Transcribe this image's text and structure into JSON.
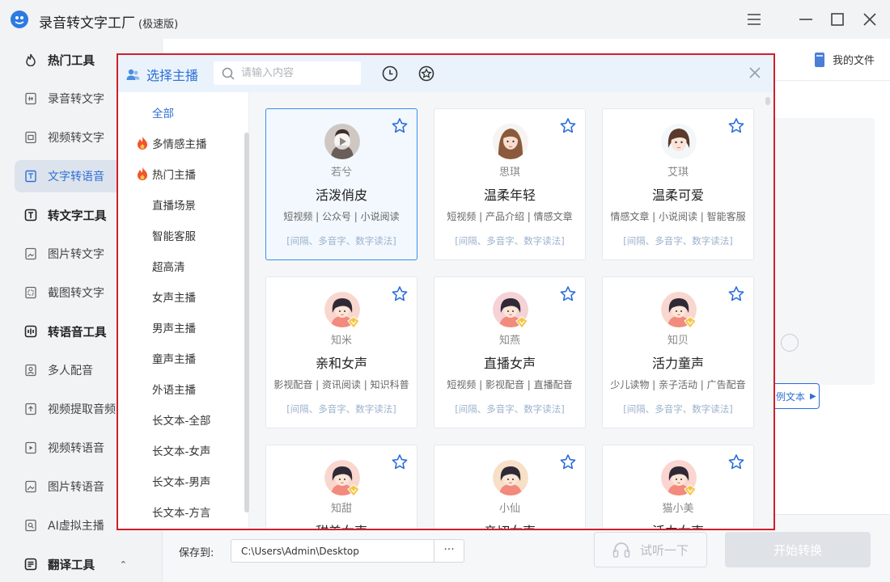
{
  "app": {
    "title": "录音转文字工厂",
    "edition": "(极速版)"
  },
  "sidebar": {
    "items": [
      {
        "label": "热门工具",
        "type": "section",
        "icon": "flame-outline-icon"
      },
      {
        "label": "录音转文字",
        "type": "item",
        "icon": "audio-file-icon"
      },
      {
        "label": "视频转文字",
        "type": "item",
        "icon": "video-file-icon"
      },
      {
        "label": "文字转语音",
        "type": "item",
        "icon": "text-file-icon",
        "active": true
      },
      {
        "label": "转文字工具",
        "type": "section",
        "icon": "text-t-icon"
      },
      {
        "label": "图片转文字",
        "type": "item",
        "icon": "image-file-icon"
      },
      {
        "label": "截图转文字",
        "type": "item",
        "icon": "screenshot-icon"
      },
      {
        "label": "转语音工具",
        "type": "section",
        "icon": "waveform-icon"
      },
      {
        "label": "多人配音",
        "type": "item",
        "icon": "person-icon"
      },
      {
        "label": "视频提取音频",
        "type": "item",
        "icon": "extract-audio-icon"
      },
      {
        "label": "视频转语音",
        "type": "item",
        "icon": "play-file-icon"
      },
      {
        "label": "图片转语音",
        "type": "item",
        "icon": "picture-icon"
      },
      {
        "label": "AI虚拟主播",
        "type": "item",
        "icon": "ai-anchor-icon"
      },
      {
        "label": "翻译工具",
        "type": "section",
        "icon": "translate-icon"
      }
    ]
  },
  "main": {
    "my_files": "我的文件",
    "example_text": "例文本",
    "save_label": "保存到:",
    "save_path": "C:\\Users\\Admin\\Desktop",
    "path_more": "···",
    "listen_label": "试听一下",
    "start_label": "开始转换"
  },
  "modal": {
    "title": "选择主播",
    "search_placeholder": "请输入内容",
    "categories": [
      {
        "label": "全部",
        "active": true
      },
      {
        "label": "多情感主播",
        "hot": true
      },
      {
        "label": "热门主播",
        "hot": true
      },
      {
        "label": "直播场景"
      },
      {
        "label": "智能客服"
      },
      {
        "label": "超高清"
      },
      {
        "label": "女声主播"
      },
      {
        "label": "男声主播"
      },
      {
        "label": "童声主播"
      },
      {
        "label": "外语主播"
      },
      {
        "label": "长文本-全部"
      },
      {
        "label": "长文本-女声"
      },
      {
        "label": "长文本-男声"
      },
      {
        "label": "长文本-方言"
      }
    ],
    "anchors": [
      {
        "name": "若兮",
        "style": "活泼俏皮",
        "tags": "短视频 | 公众号 | 小说阅读",
        "features": "[间隔、多音字、数字读法]",
        "selected": true,
        "avatar": "play"
      },
      {
        "name": "思琪",
        "style": "温柔年轻",
        "tags": "短视频 | 产品介绍 | 情感文章",
        "features": "[间隔、多音字、数字读法]",
        "avatar": "long-hair"
      },
      {
        "name": "艾琪",
        "style": "温柔可爱",
        "tags": "情感文章 | 小说阅读 | 智能客服",
        "features": "[间隔、多音字、数字读法]",
        "avatar": "cute"
      },
      {
        "name": "知米",
        "style": "亲和女声",
        "tags": "影视配音 | 资讯阅读 | 知识科普",
        "features": "[间隔、多音字、数字读法]",
        "avatar": "cartoon",
        "badge": true
      },
      {
        "name": "知燕",
        "style": "直播女声",
        "tags": "短视频 | 影视配音 | 直播配音",
        "features": "[间隔、多音字、数字读法]",
        "avatar": "cartoon",
        "badge": true
      },
      {
        "name": "知贝",
        "style": "活力童声",
        "tags": "少儿读物 | 亲子活动 | 广告配音",
        "features": "[间隔、多音字、数字读法]",
        "avatar": "cartoon",
        "badge": true
      },
      {
        "name": "知甜",
        "style": "甜美女声",
        "tags": "",
        "features": "",
        "avatar": "cartoon",
        "badge": true
      },
      {
        "name": "小仙",
        "style": "亲切女声",
        "tags": "",
        "features": "",
        "avatar": "cartoon"
      },
      {
        "name": "猫小美",
        "style": "活力女声",
        "tags": "",
        "features": "",
        "avatar": "cartoon",
        "badge": true
      }
    ]
  },
  "colors": {
    "accent": "#2d6fd6",
    "modal_border": "#d01f2a",
    "hot": "#f0542d"
  }
}
